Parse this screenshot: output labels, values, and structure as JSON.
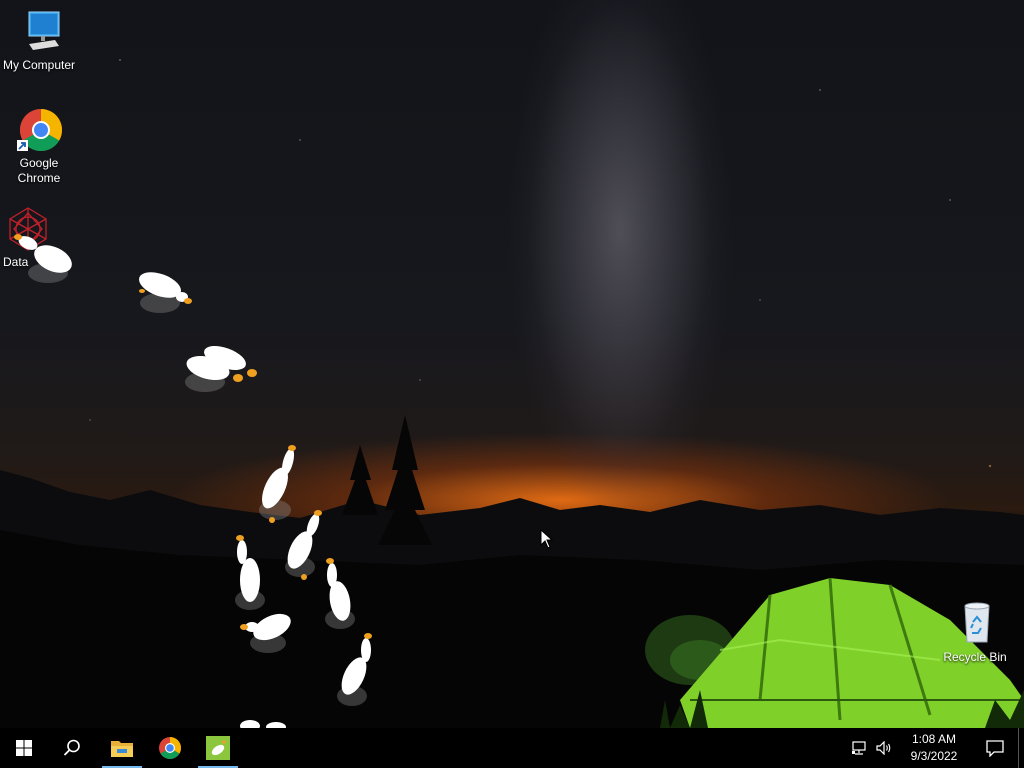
{
  "desktop": {
    "icons": [
      {
        "label": "My Computer",
        "icon": "computer-icon"
      },
      {
        "label": "Google Chrome",
        "icon": "chrome-icon"
      },
      {
        "label": "Data",
        "icon": "data-app-icon"
      },
      {
        "label": "Recycle Bin",
        "icon": "recycle-bin-icon"
      }
    ]
  },
  "taskbar": {
    "start": "windows-start-icon",
    "search": "search-icon",
    "pinned": [
      {
        "name": "File Explorer",
        "icon": "folder-icon",
        "active": true
      },
      {
        "name": "Google Chrome",
        "icon": "chrome-icon",
        "active": false
      },
      {
        "name": "Desktop Goose",
        "icon": "goose-app-icon",
        "active": true
      }
    ],
    "tray": {
      "network_icon": "network-icon",
      "volume_icon": "volume-icon",
      "time": "1:08 AM",
      "date": "9/3/2022",
      "notifications_icon": "action-center-icon"
    }
  },
  "colors": {
    "accent": "#76b9ed",
    "taskbar_bg": "#000000",
    "tent_green": "#7fd12a",
    "goose_beak": "#f0a020"
  }
}
